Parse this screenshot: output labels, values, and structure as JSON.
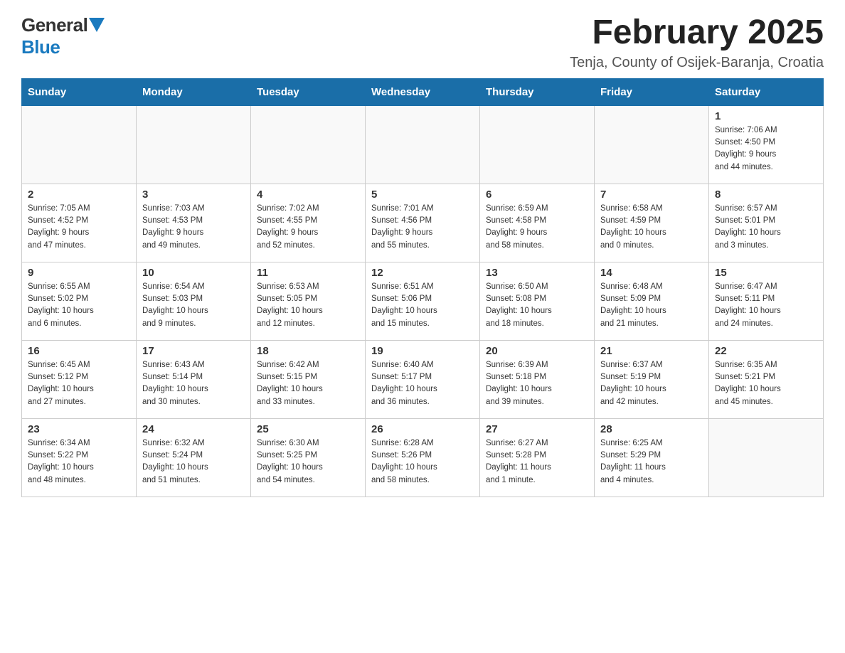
{
  "logo": {
    "general": "General",
    "blue": "Blue"
  },
  "header": {
    "title": "February 2025",
    "location": "Tenja, County of Osijek-Baranja, Croatia"
  },
  "days_of_week": [
    "Sunday",
    "Monday",
    "Tuesday",
    "Wednesday",
    "Thursday",
    "Friday",
    "Saturday"
  ],
  "weeks": [
    [
      {
        "day": "",
        "info": ""
      },
      {
        "day": "",
        "info": ""
      },
      {
        "day": "",
        "info": ""
      },
      {
        "day": "",
        "info": ""
      },
      {
        "day": "",
        "info": ""
      },
      {
        "day": "",
        "info": ""
      },
      {
        "day": "1",
        "info": "Sunrise: 7:06 AM\nSunset: 4:50 PM\nDaylight: 9 hours\nand 44 minutes."
      }
    ],
    [
      {
        "day": "2",
        "info": "Sunrise: 7:05 AM\nSunset: 4:52 PM\nDaylight: 9 hours\nand 47 minutes."
      },
      {
        "day": "3",
        "info": "Sunrise: 7:03 AM\nSunset: 4:53 PM\nDaylight: 9 hours\nand 49 minutes."
      },
      {
        "day": "4",
        "info": "Sunrise: 7:02 AM\nSunset: 4:55 PM\nDaylight: 9 hours\nand 52 minutes."
      },
      {
        "day": "5",
        "info": "Sunrise: 7:01 AM\nSunset: 4:56 PM\nDaylight: 9 hours\nand 55 minutes."
      },
      {
        "day": "6",
        "info": "Sunrise: 6:59 AM\nSunset: 4:58 PM\nDaylight: 9 hours\nand 58 minutes."
      },
      {
        "day": "7",
        "info": "Sunrise: 6:58 AM\nSunset: 4:59 PM\nDaylight: 10 hours\nand 0 minutes."
      },
      {
        "day": "8",
        "info": "Sunrise: 6:57 AM\nSunset: 5:01 PM\nDaylight: 10 hours\nand 3 minutes."
      }
    ],
    [
      {
        "day": "9",
        "info": "Sunrise: 6:55 AM\nSunset: 5:02 PM\nDaylight: 10 hours\nand 6 minutes."
      },
      {
        "day": "10",
        "info": "Sunrise: 6:54 AM\nSunset: 5:03 PM\nDaylight: 10 hours\nand 9 minutes."
      },
      {
        "day": "11",
        "info": "Sunrise: 6:53 AM\nSunset: 5:05 PM\nDaylight: 10 hours\nand 12 minutes."
      },
      {
        "day": "12",
        "info": "Sunrise: 6:51 AM\nSunset: 5:06 PM\nDaylight: 10 hours\nand 15 minutes."
      },
      {
        "day": "13",
        "info": "Sunrise: 6:50 AM\nSunset: 5:08 PM\nDaylight: 10 hours\nand 18 minutes."
      },
      {
        "day": "14",
        "info": "Sunrise: 6:48 AM\nSunset: 5:09 PM\nDaylight: 10 hours\nand 21 minutes."
      },
      {
        "day": "15",
        "info": "Sunrise: 6:47 AM\nSunset: 5:11 PM\nDaylight: 10 hours\nand 24 minutes."
      }
    ],
    [
      {
        "day": "16",
        "info": "Sunrise: 6:45 AM\nSunset: 5:12 PM\nDaylight: 10 hours\nand 27 minutes."
      },
      {
        "day": "17",
        "info": "Sunrise: 6:43 AM\nSunset: 5:14 PM\nDaylight: 10 hours\nand 30 minutes."
      },
      {
        "day": "18",
        "info": "Sunrise: 6:42 AM\nSunset: 5:15 PM\nDaylight: 10 hours\nand 33 minutes."
      },
      {
        "day": "19",
        "info": "Sunrise: 6:40 AM\nSunset: 5:17 PM\nDaylight: 10 hours\nand 36 minutes."
      },
      {
        "day": "20",
        "info": "Sunrise: 6:39 AM\nSunset: 5:18 PM\nDaylight: 10 hours\nand 39 minutes."
      },
      {
        "day": "21",
        "info": "Sunrise: 6:37 AM\nSunset: 5:19 PM\nDaylight: 10 hours\nand 42 minutes."
      },
      {
        "day": "22",
        "info": "Sunrise: 6:35 AM\nSunset: 5:21 PM\nDaylight: 10 hours\nand 45 minutes."
      }
    ],
    [
      {
        "day": "23",
        "info": "Sunrise: 6:34 AM\nSunset: 5:22 PM\nDaylight: 10 hours\nand 48 minutes."
      },
      {
        "day": "24",
        "info": "Sunrise: 6:32 AM\nSunset: 5:24 PM\nDaylight: 10 hours\nand 51 minutes."
      },
      {
        "day": "25",
        "info": "Sunrise: 6:30 AM\nSunset: 5:25 PM\nDaylight: 10 hours\nand 54 minutes."
      },
      {
        "day": "26",
        "info": "Sunrise: 6:28 AM\nSunset: 5:26 PM\nDaylight: 10 hours\nand 58 minutes."
      },
      {
        "day": "27",
        "info": "Sunrise: 6:27 AM\nSunset: 5:28 PM\nDaylight: 11 hours\nand 1 minute."
      },
      {
        "day": "28",
        "info": "Sunrise: 6:25 AM\nSunset: 5:29 PM\nDaylight: 11 hours\nand 4 minutes."
      },
      {
        "day": "",
        "info": ""
      }
    ]
  ]
}
